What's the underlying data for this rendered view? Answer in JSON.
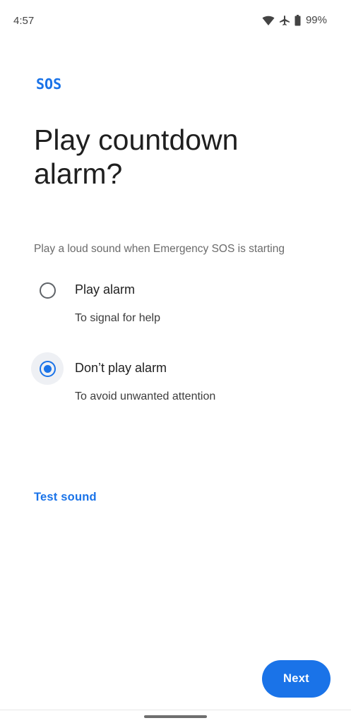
{
  "status_bar": {
    "time": "4:57",
    "battery_percent": "99%",
    "icons": [
      "wifi-icon",
      "airplane-icon",
      "battery-icon"
    ]
  },
  "header": {
    "logo_text": "SOS",
    "title": "Play countdown alarm?"
  },
  "description": "Play a loud sound when Emergency SOS is starting",
  "options": [
    {
      "label": "Play alarm",
      "sublabel": "To signal for help",
      "selected": false
    },
    {
      "label": "Don’t play alarm",
      "sublabel": "To avoid unwanted attention",
      "selected": true
    }
  ],
  "actions": {
    "test_sound_label": "Test sound",
    "next_label": "Next"
  },
  "colors": {
    "accent": "#1a73e8",
    "text_primary": "#1f1f1f",
    "text_secondary": "#6b6b6b"
  }
}
